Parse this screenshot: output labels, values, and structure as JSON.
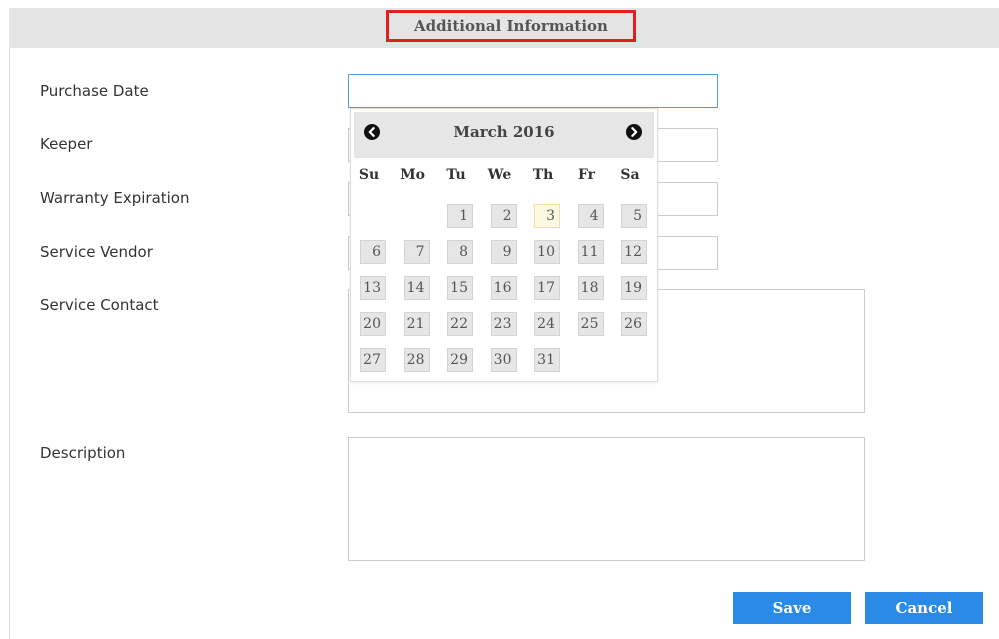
{
  "section": {
    "title": "Additional Information"
  },
  "fields": {
    "purchase_date": {
      "label": "Purchase Date",
      "value": ""
    },
    "keeper": {
      "label": "Keeper",
      "value": ""
    },
    "warranty_expiration": {
      "label": "Warranty Expiration",
      "value": ""
    },
    "service_vendor": {
      "label": "Service Vendor",
      "value": ""
    },
    "service_contact": {
      "label": "Service Contact",
      "value": ""
    },
    "description": {
      "label": "Description",
      "value": ""
    }
  },
  "datepicker": {
    "title": "March 2016",
    "prev_icon": "chevron-left-circle-icon",
    "next_icon": "chevron-right-circle-icon",
    "weekdays": [
      "Su",
      "Mo",
      "Tu",
      "We",
      "Th",
      "Fr",
      "Sa"
    ],
    "today": "3",
    "days": [
      "1",
      "2",
      "3",
      "4",
      "5",
      "6",
      "7",
      "8",
      "9",
      "10",
      "11",
      "12",
      "13",
      "14",
      "15",
      "16",
      "17",
      "18",
      "19",
      "20",
      "21",
      "22",
      "23",
      "24",
      "25",
      "26",
      "27",
      "28",
      "29",
      "30",
      "31"
    ],
    "today_highlight_color": "#fcf8e3"
  },
  "buttons": {
    "save": "Save",
    "cancel": "Cancel"
  },
  "colors": {
    "accent": "#2a8ae8",
    "title_outline": "#e02020",
    "focus_border": "#5b9bd5"
  }
}
